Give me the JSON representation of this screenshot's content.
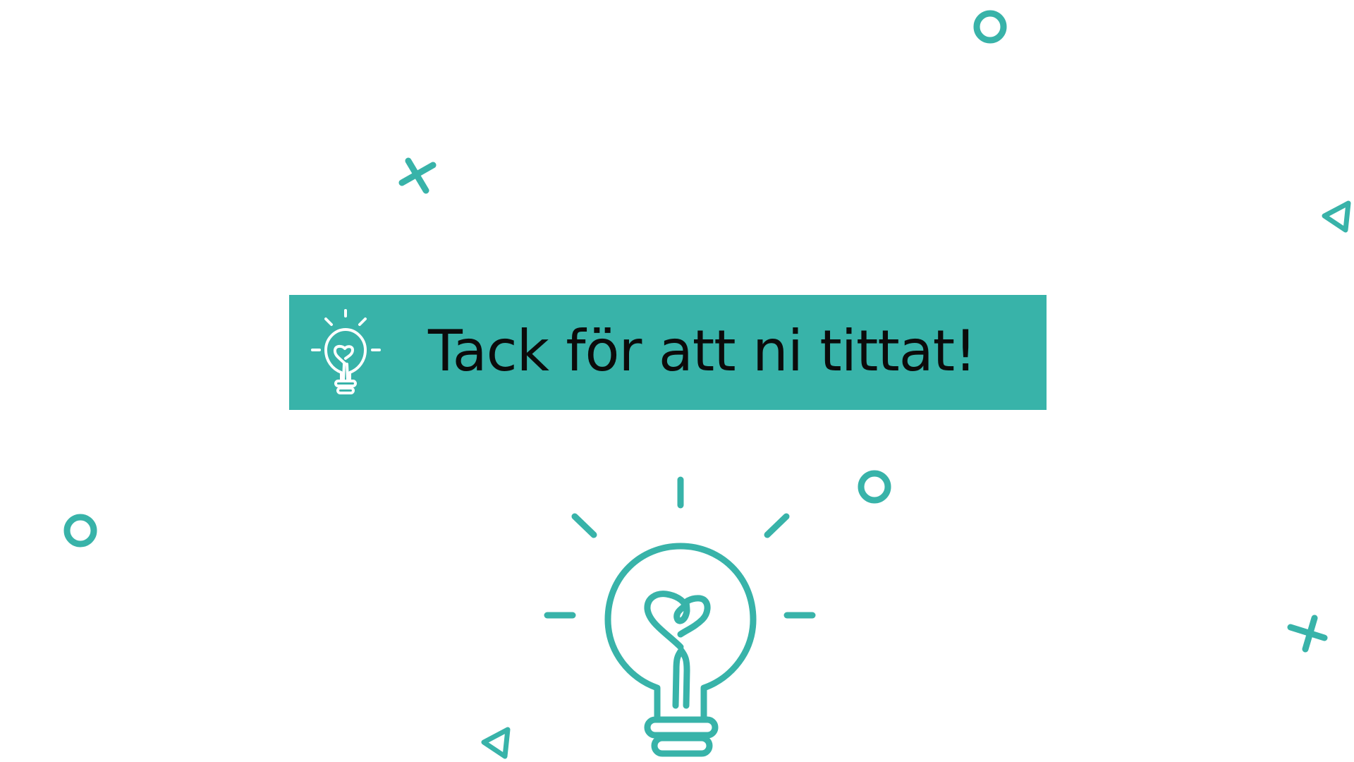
{
  "slide": {
    "title": "Tack för att ni tittat!"
  },
  "colors": {
    "accent": "#38b3a9",
    "banner_background": "#38b3a9",
    "title_text": "#0b0b0b",
    "background": "#ffffff",
    "banner_icon": "#ffffff"
  },
  "icons": {
    "banner": "lightbulb-heart-icon",
    "illustration": "lightbulb-heart-icon",
    "decorations": [
      "circle-icon",
      "cross-icon",
      "triangle-icon"
    ]
  }
}
